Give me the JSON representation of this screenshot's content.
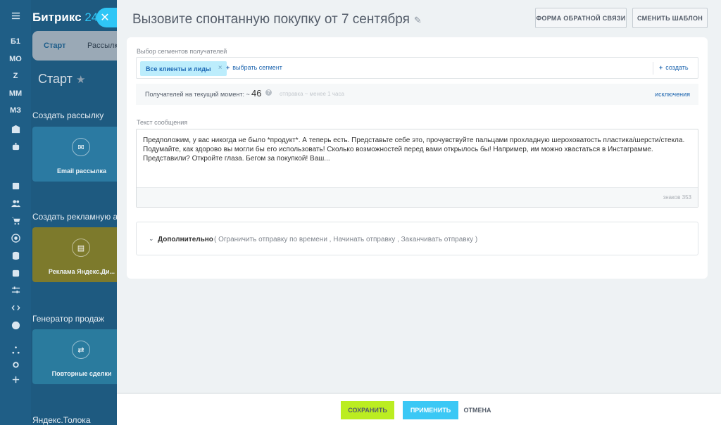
{
  "rail": {
    "items": [
      "Б1",
      "МО",
      "Z",
      "ММ",
      "МЗ"
    ]
  },
  "background": {
    "logo_text": "Битрикс",
    "logo_num": "24",
    "tabs": [
      "Старт",
      "Рассылки"
    ],
    "start_label": "Старт",
    "sections": [
      {
        "title": "Создать рассылку",
        "card_label": "Email рассылка"
      },
      {
        "title": "Создать рекламную аудиторию",
        "card_label": "Реклама Яндекс.Ди..."
      },
      {
        "title": "Генератор продаж",
        "card_label": "Повторные сделки"
      },
      {
        "title": "Яндекс.Толока"
      }
    ]
  },
  "header": {
    "title": "Вызовите спонтанную покупку от 7 сентября",
    "feedback_label": "ФОРМА ОБРАТНОЙ СВЯЗИ",
    "change_template_label": "СМЕНИТЬ ШАБЛОН"
  },
  "segments": {
    "label": "Выбор сегментов получателей",
    "chip": "Все клиенты и лиды",
    "select_label": "выбрать сегмент",
    "create_label": "создать"
  },
  "recipients": {
    "label": "Получателей на текущий момент: ~",
    "count": "46",
    "note": "отправка ~ менее 1 часа",
    "exclusions_label": "исключения"
  },
  "message": {
    "label": "Текст сообщения",
    "text": "Предположим, у вас никогда не было *продукт*. А теперь есть. Представьте себе это, прочувствуйте пальцами прохладную шероховатость пластика/шерсти/стекла. Подумайте, как здорово вы могли бы его использовать! Сколько возможностей перед вами открылось бы! Например, им можно хвастаться в Инстаграмме. Представили? Откройте глаза. Бегом за покупкой! Ваш...",
    "char_count": "знаков 353"
  },
  "extra": {
    "title": "Дополнительно",
    "options": "( Ограничить отправку по времени ,  Начинать отправку ,  Заканчивать отправку  )"
  },
  "footer": {
    "save_label": "СОХРАНИТЬ",
    "apply_label": "ПРИМЕНИТЬ",
    "cancel_label": "ОТМЕНА"
  },
  "colors": {
    "save": "#bbed21",
    "apply": "#3bc8f5",
    "link": "#2067b0"
  }
}
